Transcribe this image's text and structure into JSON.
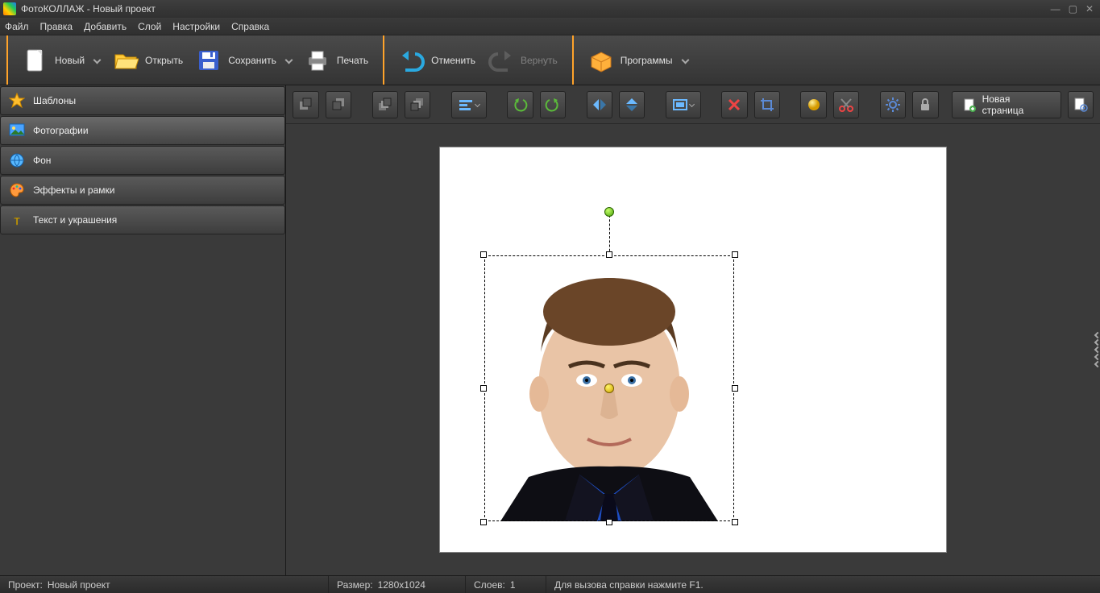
{
  "title": "ФотоКОЛЛАЖ - Новый проект",
  "menu": {
    "file": "Файл",
    "edit": "Правка",
    "add": "Добавить",
    "layer": "Слой",
    "settings": "Настройки",
    "help": "Справка"
  },
  "ribbon": {
    "new": "Новый",
    "open": "Открыть",
    "save": "Сохранить",
    "print": "Печать",
    "undo": "Отменить",
    "redo": "Вернуть",
    "programs": "Программы"
  },
  "sidebar": {
    "templates": "Шаблоны",
    "photos": "Фотографии",
    "background": "Фон",
    "effects": "Эффекты и рамки",
    "text": "Текст и украшения"
  },
  "toolbar_right": {
    "new_page": "Новая страница"
  },
  "status": {
    "project_label": "Проект:",
    "project_name": "Новый проект",
    "size_label": "Размер:",
    "size_value": "1280x1024",
    "layers_label": "Слоев:",
    "layers_value": "1",
    "hint": "Для вызова справки нажмите F1."
  }
}
